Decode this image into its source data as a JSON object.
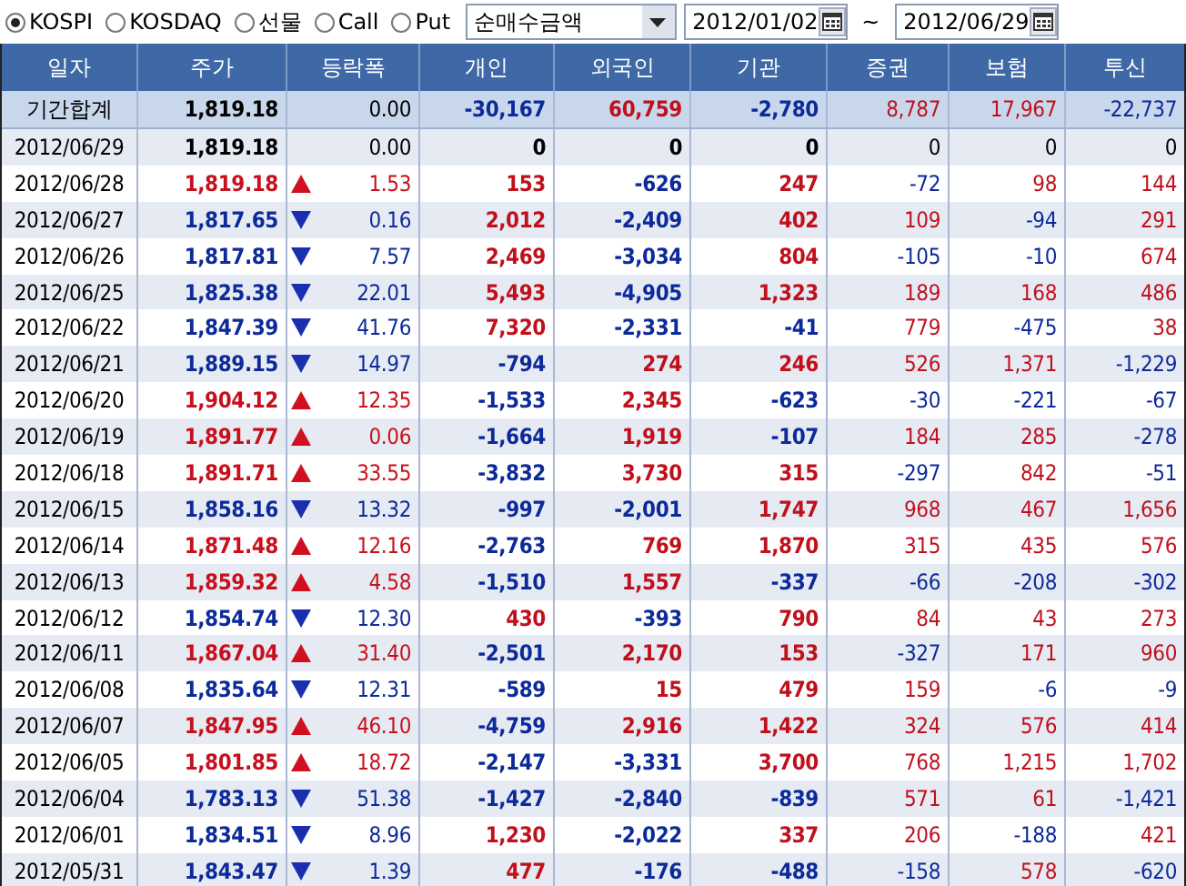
{
  "toolbar": {
    "markets": [
      {
        "label": "KOSPI",
        "selected": true
      },
      {
        "label": "KOSDAQ",
        "selected": false
      },
      {
        "label": "선물",
        "selected": false
      },
      {
        "label": "Call",
        "selected": false
      },
      {
        "label": "Put",
        "selected": false
      }
    ],
    "measure": {
      "value": "순매수금액"
    },
    "date_from": {
      "value": "2012/01/02"
    },
    "separator": "~",
    "date_to": {
      "value": "2012/06/29"
    }
  },
  "table": {
    "columns": [
      "일자",
      "주가",
      "등락폭",
      "개인",
      "외국인",
      "기관",
      "증권",
      "보험",
      "투신"
    ],
    "summary": {
      "cells": [
        "기간합계",
        "1,819.18",
        "0.00",
        "-30,167",
        "60,759",
        "-2,780",
        "8,787",
        "17,967",
        "-22,737"
      ]
    },
    "rows": [
      {
        "rising": false,
        "falling": false,
        "cells": [
          "2012/06/29",
          "1,819.18",
          "0.00",
          "0",
          "0",
          "0",
          "0",
          "0",
          "0"
        ]
      },
      {
        "rising": true,
        "falling": false,
        "cells": [
          "2012/06/28",
          "1,819.18",
          "1.53",
          "153",
          "-626",
          "247",
          "-72",
          "98",
          "144"
        ]
      },
      {
        "rising": false,
        "falling": true,
        "cells": [
          "2012/06/27",
          "1,817.65",
          "0.16",
          "2,012",
          "-2,409",
          "402",
          "109",
          "-94",
          "291"
        ]
      },
      {
        "rising": false,
        "falling": true,
        "cells": [
          "2012/06/26",
          "1,817.81",
          "7.57",
          "2,469",
          "-3,034",
          "804",
          "-105",
          "-10",
          "674"
        ]
      },
      {
        "rising": false,
        "falling": true,
        "cells": [
          "2012/06/25",
          "1,825.38",
          "22.01",
          "5,493",
          "-4,905",
          "1,323",
          "189",
          "168",
          "486"
        ]
      },
      {
        "rising": false,
        "falling": true,
        "cells": [
          "2012/06/22",
          "1,847.39",
          "41.76",
          "7,320",
          "-2,331",
          "-41",
          "779",
          "-475",
          "38"
        ]
      },
      {
        "rising": false,
        "falling": true,
        "cells": [
          "2012/06/21",
          "1,889.15",
          "14.97",
          "-794",
          "274",
          "246",
          "526",
          "1,371",
          "-1,229"
        ]
      },
      {
        "rising": true,
        "falling": false,
        "cells": [
          "2012/06/20",
          "1,904.12",
          "12.35",
          "-1,533",
          "2,345",
          "-623",
          "-30",
          "-221",
          "-67"
        ]
      },
      {
        "rising": true,
        "falling": false,
        "cells": [
          "2012/06/19",
          "1,891.77",
          "0.06",
          "-1,664",
          "1,919",
          "-107",
          "184",
          "285",
          "-278"
        ]
      },
      {
        "rising": true,
        "falling": false,
        "cells": [
          "2012/06/18",
          "1,891.71",
          "33.55",
          "-3,832",
          "3,730",
          "315",
          "-297",
          "842",
          "-51"
        ]
      },
      {
        "rising": false,
        "falling": true,
        "cells": [
          "2012/06/15",
          "1,858.16",
          "13.32",
          "-997",
          "-2,001",
          "1,747",
          "968",
          "467",
          "1,656"
        ]
      },
      {
        "rising": true,
        "falling": false,
        "cells": [
          "2012/06/14",
          "1,871.48",
          "12.16",
          "-2,763",
          "769",
          "1,870",
          "315",
          "435",
          "576"
        ]
      },
      {
        "rising": true,
        "falling": false,
        "cells": [
          "2012/06/13",
          "1,859.32",
          "4.58",
          "-1,510",
          "1,557",
          "-337",
          "-66",
          "-208",
          "-302"
        ]
      },
      {
        "rising": false,
        "falling": true,
        "cells": [
          "2012/06/12",
          "1,854.74",
          "12.30",
          "430",
          "-393",
          "790",
          "84",
          "43",
          "273"
        ]
      },
      {
        "rising": true,
        "falling": false,
        "cells": [
          "2012/06/11",
          "1,867.04",
          "31.40",
          "-2,501",
          "2,170",
          "153",
          "-327",
          "171",
          "960"
        ]
      },
      {
        "rising": false,
        "falling": true,
        "cells": [
          "2012/06/08",
          "1,835.64",
          "12.31",
          "-589",
          "15",
          "479",
          "159",
          "-6",
          "-9"
        ]
      },
      {
        "rising": true,
        "falling": false,
        "cells": [
          "2012/06/07",
          "1,847.95",
          "46.10",
          "-4,759",
          "2,916",
          "1,422",
          "324",
          "576",
          "414"
        ]
      },
      {
        "rising": true,
        "falling": false,
        "cells": [
          "2012/06/05",
          "1,801.85",
          "18.72",
          "-2,147",
          "-3,331",
          "3,700",
          "768",
          "1,215",
          "1,702"
        ]
      },
      {
        "rising": false,
        "falling": true,
        "cells": [
          "2012/06/04",
          "1,783.13",
          "51.38",
          "-1,427",
          "-2,840",
          "-839",
          "571",
          "61",
          "-1,421"
        ]
      },
      {
        "rising": false,
        "falling": true,
        "cells": [
          "2012/06/01",
          "1,834.51",
          "8.96",
          "1,230",
          "-2,022",
          "337",
          "206",
          "-188",
          "421"
        ]
      },
      {
        "rising": false,
        "falling": true,
        "cells": [
          "2012/05/31",
          "1,843.47",
          "1.39",
          "477",
          "-176",
          "-488",
          "-158",
          "578",
          "-620"
        ]
      }
    ]
  }
}
